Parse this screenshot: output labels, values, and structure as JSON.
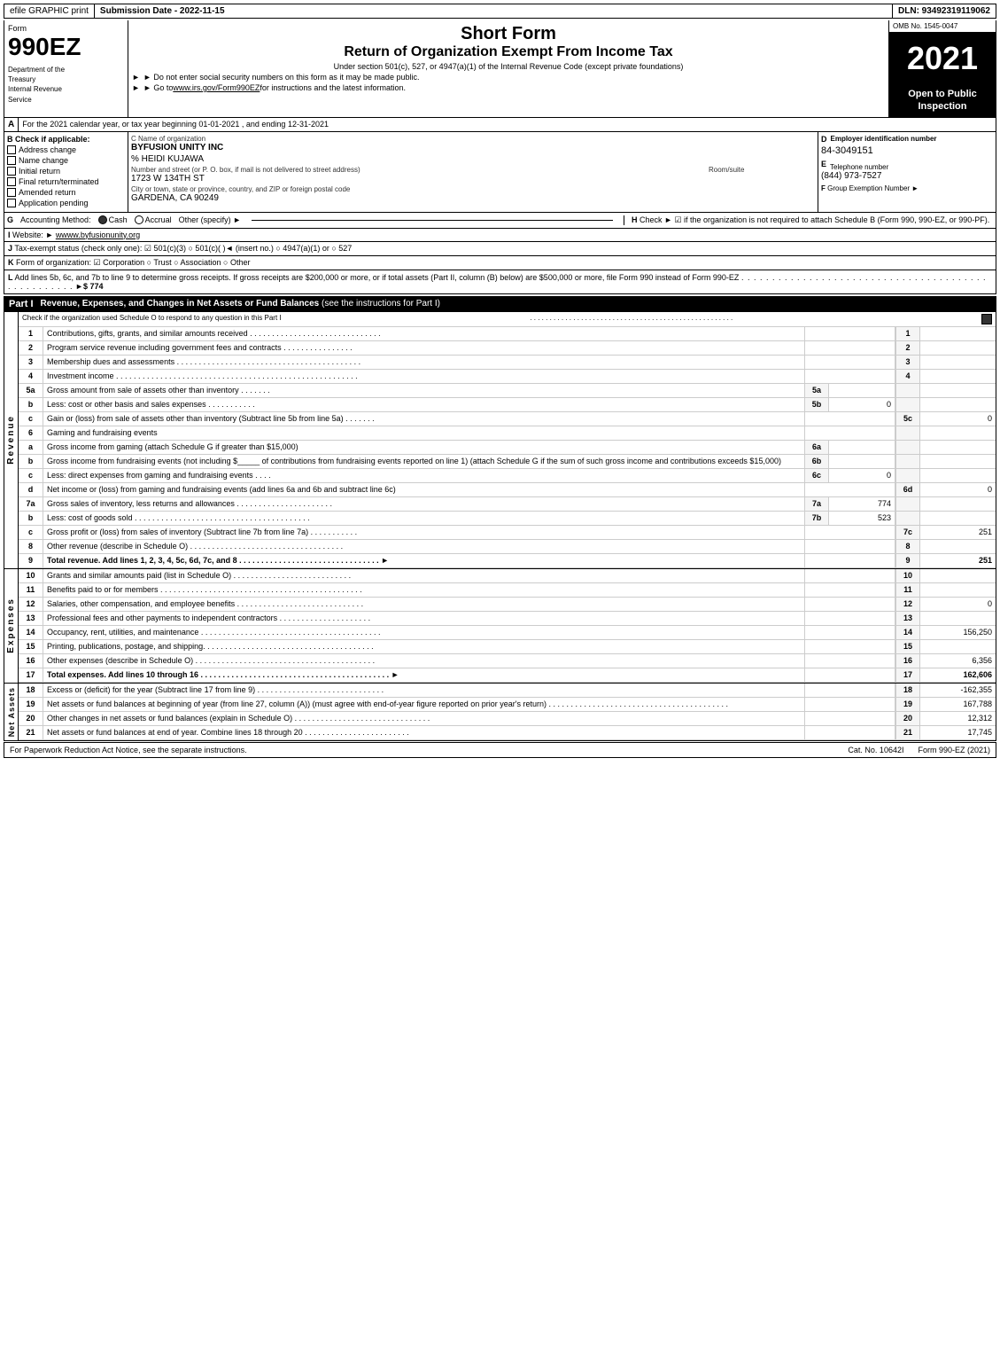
{
  "header": {
    "efile_label": "efile GRAPHIC print",
    "submission_date_label": "Submission Date - 2022-11-15",
    "dln_label": "DLN: 93492319119062",
    "form_label": "Form",
    "form_number": "990EZ",
    "dept_line1": "Department of the",
    "dept_line2": "Treasury",
    "dept_line3": "Internal Revenue",
    "dept_line4": "Service",
    "short_form": "Short Form",
    "return_title": "Return of Organization Exempt From Income Tax",
    "subtitle": "Under section 501(c), 527, or 4947(a)(1) of the Internal Revenue Code (except private foundations)",
    "notice1": "► Do not enter social security numbers on this form as it may be made public.",
    "notice2": "► Go to ",
    "notice2_link": "www.irs.gov/Form990EZ",
    "notice2_end": " for instructions and the latest information.",
    "year": "2021",
    "omb": "OMB No. 1545-0047",
    "open_to_public": "Open to Public Inspection"
  },
  "section_a": {
    "label": "A",
    "text": "For the 2021 calendar year, or tax year beginning 01-01-2021 , and ending 12-31-2021"
  },
  "section_b": {
    "label": "B",
    "title": "Check if applicable:",
    "items": [
      {
        "id": "address_change",
        "label": "Address change",
        "checked": false
      },
      {
        "id": "name_change",
        "label": "Name change",
        "checked": false
      },
      {
        "id": "initial_return",
        "label": "Initial return",
        "checked": false
      },
      {
        "id": "final_return",
        "label": "Final return/terminated",
        "checked": false
      },
      {
        "id": "amended_return",
        "label": "Amended return",
        "checked": false
      },
      {
        "id": "application_pending",
        "label": "Application pending",
        "checked": false
      }
    ]
  },
  "org_info": {
    "c_label": "C Name of organization",
    "org_name": "BYFUSION UNITY INC",
    "contact": "% HEIDI KUJAWA",
    "address_label": "Number and street (or P. O. box, if mail is not delivered to street address)",
    "address": "1723 W 134TH ST",
    "room_label": "Room/suite",
    "room": "",
    "city_label": "City or town, state or province, country, and ZIP or foreign postal code",
    "city": "GARDENA, CA  90249"
  },
  "d_section": {
    "label": "D",
    "title": "Employer identification number",
    "ein": "84-3049151",
    "e_label": "E",
    "phone_title": "Telephone number",
    "phone": "(844) 973-7527",
    "f_label": "F",
    "group_ex": "Group Exemption Number",
    "arrow": "►"
  },
  "accounting": {
    "g_label": "G",
    "title": "Accounting Method:",
    "cash_label": "Cash",
    "accrual_label": "Accrual",
    "other_label": "Other (specify) ►",
    "h_label": "H",
    "h_text": "Check ► ☑ if the organization is not required to attach Schedule B (Form 990, 990-EZ, or 990-PF)."
  },
  "website": {
    "i_label": "I",
    "label": "Website: ►",
    "url": "wwww.byfusionunity.org"
  },
  "tax_exempt": {
    "j_label": "J",
    "text": "Tax-exempt status (check only one): ☑ 501(c)(3)  ○ 501(c)(   )◄ (insert no.)  ○ 4947(a)(1) or  ○ 527"
  },
  "form_org": {
    "k_label": "K",
    "text": "Form of organization: ☑ Corporation  ○ Trust  ○ Association  ○ Other"
  },
  "add_lines": {
    "l_label": "L",
    "text": "Add lines 5b, 6c, and 7b to line 9 to determine gross receipts. If gross receipts are $200,000 or more, or if total assets (Part II, column (B) below) are $500,000 or more, file Form 990 instead of Form 990-EZ",
    "dots": ". . . . . . . . . . . . . . . . . . . . . . . . . . . . . . . . . . . . . . . . . . . . . . . . . . .",
    "arrow": "►$",
    "amount": "774"
  },
  "part1": {
    "label": "Part I",
    "title": "Revenue, Expenses, and Changes in Net Assets or Fund Balances",
    "see_note": "(see the instructions for Part I)",
    "check_note": "Check if the organization used Schedule O to respond to any question in this Part I",
    "dots": ". . . . . . . . . . . . . . . . . . . . . . . . . . . . . . . . . . . . . . . . . . . . . . . . . . . .",
    "rows": [
      {
        "num": "1",
        "desc": "Contributions, gifts, grants, and similar amounts received",
        "dots": ". . . . . . . . . . . . . . . . . . . . . . . . . . . . . .",
        "line_num": "1",
        "value": ""
      },
      {
        "num": "2",
        "desc": "Program service revenue including government fees and contracts",
        "dots": ". . . . . . . . . . . . . . . .",
        "line_num": "2",
        "value": ""
      },
      {
        "num": "3",
        "desc": "Membership dues and assessments",
        "dots": ". . . . . . . . . . . . . . . . . . . . . . . . . . . . . . . . . . . . . . . . . .",
        "line_num": "3",
        "value": ""
      },
      {
        "num": "4",
        "desc": "Investment income",
        "dots": ". . . . . . . . . . . . . . . . . . . . . . . . . . . . . . . . . . . . . . . . . . . . . . . . . . . . . . .",
        "line_num": "4",
        "value": ""
      },
      {
        "num": "5a",
        "desc": "Gross amount from sale of assets other than inventory",
        "dots": ". . . . . . .",
        "sub_label": "5a",
        "sub_value": "",
        "line_num": "",
        "value": ""
      },
      {
        "num": "b",
        "desc": "Less: cost or other basis and sales expenses",
        "dots": ". . . . . . . . . . .",
        "sub_label": "5b",
        "sub_value": "0",
        "line_num": "",
        "value": ""
      },
      {
        "num": "c",
        "desc": "Gain or (loss) from sale of assets other than inventory (Subtract line 5b from line 5a)",
        "dots": ". . . . . . .",
        "sub_label": "",
        "sub_value": "",
        "line_num": "5c",
        "value": "0"
      },
      {
        "num": "6",
        "desc": "Gaming and fundraising events",
        "dots": "",
        "sub_label": "",
        "sub_value": "",
        "line_num": "",
        "value": ""
      },
      {
        "num": "a",
        "desc": "Gross income from gaming (attach Schedule G if greater than $15,000)",
        "dots": "",
        "sub_label": "6a",
        "sub_value": "",
        "line_num": "",
        "value": ""
      },
      {
        "num": "b",
        "desc": "Gross income from fundraising events (not including $_____ of contributions from fundraising events reported on line 1) (attach Schedule G if the sum of such gross income and contributions exceeds $15,000)",
        "dots": "",
        "sub_label": "6b",
        "sub_value": "",
        "line_num": "",
        "value": ""
      },
      {
        "num": "c",
        "desc": "Less: direct expenses from gaming and fundraising events",
        "dots": ". . . .",
        "sub_label": "6c",
        "sub_value": "0",
        "line_num": "",
        "value": ""
      },
      {
        "num": "d",
        "desc": "Net income or (loss) from gaming and fundraising events (add lines 6a and 6b and subtract line 6c)",
        "dots": "",
        "sub_label": "",
        "sub_value": "",
        "line_num": "6d",
        "value": "0"
      },
      {
        "num": "7a",
        "desc": "Gross sales of inventory, less returns and allowances",
        "dots": ". . . . . . . . . . . . . . . . . . . . . .",
        "sub_label": "7a",
        "sub_value": "774",
        "line_num": "",
        "value": ""
      },
      {
        "num": "b",
        "desc": "Less: cost of goods sold",
        "dots": ". . . . . . . . . . . . . . . . . . . . . . . . . . . . . . . . . . . . . . . .",
        "sub_label": "7b",
        "sub_value": "523",
        "line_num": "",
        "value": ""
      },
      {
        "num": "c",
        "desc": "Gross profit or (loss) from sales of inventory (Subtract line 7b from line 7a)",
        "dots": ". . . . . . . . . . .",
        "sub_label": "",
        "sub_value": "",
        "line_num": "7c",
        "value": "251"
      },
      {
        "num": "8",
        "desc": "Other revenue (describe in Schedule O)",
        "dots": ". . . . . . . . . . . . . . . . . . . . . . . . . . . . . . . . . . .",
        "sub_label": "",
        "sub_value": "",
        "line_num": "8",
        "value": ""
      },
      {
        "num": "9",
        "desc": "Total revenue. Add lines 1, 2, 3, 4, 5c, 6d, 7c, and 8",
        "dots": ". . . . . . . . . . . . . . . . . . . . . . . . . . . . . . . .",
        "arrow": "►",
        "line_num": "9",
        "value": "251",
        "bold": true
      }
    ]
  },
  "expenses": {
    "rows": [
      {
        "num": "10",
        "desc": "Grants and similar amounts paid (list in Schedule O)",
        "dots": ". . . . . . . . . . . . . . . . . . . . . . . . . . .",
        "line_num": "10",
        "value": ""
      },
      {
        "num": "11",
        "desc": "Benefits paid to or for members",
        "dots": ". . . . . . . . . . . . . . . . . . . . . . . . . . . . . . . . . . . . . . . . . . . . . .",
        "line_num": "11",
        "value": ""
      },
      {
        "num": "12",
        "desc": "Salaries, other compensation, and employee benefits",
        "dots": ". . . . . . . . . . . . . . . . . . . . . . . . . . . . .",
        "line_num": "12",
        "value": "0"
      },
      {
        "num": "13",
        "desc": "Professional fees and other payments to independent contractors",
        "dots": ". . . . . . . . . . . . . . . . . . . . .",
        "line_num": "13",
        "value": ""
      },
      {
        "num": "14",
        "desc": "Occupancy, rent, utilities, and maintenance",
        "dots": ". . . . . . . . . . . . . . . . . . . . . . . . . . . . . . . . . . . . . . . . .",
        "line_num": "14",
        "value": "156,250"
      },
      {
        "num": "15",
        "desc": "Printing, publications, postage, and shipping.",
        "dots": ". . . . . . . . . . . . . . . . . . . . . . . . . . . . . . . . . . . . . .",
        "line_num": "15",
        "value": ""
      },
      {
        "num": "16",
        "desc": "Other expenses (describe in Schedule O)",
        "dots": ". . . . . . . . . . . . . . . . . . . . . . . . . . . . . . . . . . . . . . . . .",
        "line_num": "16",
        "value": "6,356"
      },
      {
        "num": "17",
        "desc": "Total expenses. Add lines 10 through 16",
        "dots": ". . . . . . . . . . . . . . . . . . . . . . . . . . . . . . . . . . . . . . . . . . .",
        "arrow": "►",
        "line_num": "17",
        "value": "162,606",
        "bold": true
      }
    ]
  },
  "net_assets_rows": [
    {
      "num": "18",
      "desc": "Excess or (deficit) for the year (Subtract line 17 from line 9)",
      "dots": ". . . . . . . . . . . . . . . . . . . . . . . . . . . . .",
      "line_num": "18",
      "value": "-162,355"
    },
    {
      "num": "19",
      "desc": "Net assets or fund balances at beginning of year (from line 27, column (A)) (must agree with end-of-year figure reported on prior year's return)",
      "dots": ". . . . . . . . . . . . . . . . . . . . . . . . . . . . . . . . . . . . . . . . .",
      "line_num": "19",
      "value": "167,788"
    },
    {
      "num": "20",
      "desc": "Other changes in net assets or fund balances (explain in Schedule O)",
      "dots": ". . . . . . . . . . . . . . . . . . . . . . . . . . . . . . .",
      "line_num": "20",
      "value": "12,312"
    },
    {
      "num": "21",
      "desc": "Net assets or fund balances at end of year. Combine lines 18 through 20",
      "dots": ". . . . . . . . . . . . . . . . . . . . . . . .",
      "line_num": "21",
      "value": "17,745"
    }
  ],
  "footer": {
    "paperwork_text": "For Paperwork Reduction Act Notice, see the separate instructions.",
    "cat_no": "Cat. No. 10642I",
    "form_ref": "Form 990-EZ (2021)"
  }
}
